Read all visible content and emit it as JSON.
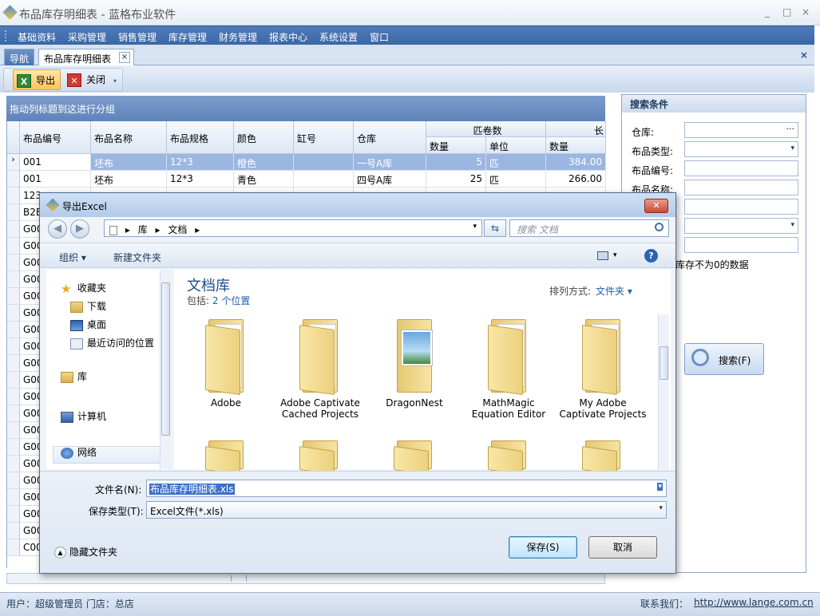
{
  "app": {
    "title": "布品库存明细表 - 蓝格布业软件",
    "window_buttons": [
      "_",
      "□",
      "×"
    ]
  },
  "menu": [
    "基础资料",
    "采购管理",
    "销售管理",
    "库存管理",
    "财务管理",
    "报表中心",
    "系统设置",
    "窗口"
  ],
  "tabs": {
    "nav": "导航",
    "detail": "布品库存明细表",
    "close_glyph": "×",
    "close_all": "×"
  },
  "toolbar": {
    "export": "导出",
    "close": "关闭"
  },
  "grid": {
    "group_hint": "拖动列标题到这进行分组",
    "headers": {
      "code": "布品编号",
      "name": "布品名称",
      "spec": "布品规格",
      "color": "颜色",
      "vat": "缸号",
      "warehouse": "仓库",
      "bolts": "匹卷数",
      "qty": "数量",
      "unit": "单位",
      "long_qty": "数量",
      "long": "长"
    },
    "rows": [
      {
        "marker": "›",
        "code": "001",
        "name": "坯布",
        "spec": "12*3",
        "color": "橙色",
        "vat": "",
        "warehouse": "一号A库",
        "qty": "5",
        "unit": "匹",
        "long_qty": "384.00"
      },
      {
        "marker": "",
        "code": "001",
        "name": "坯布",
        "spec": "12*3",
        "color": "青色",
        "vat": "",
        "warehouse": "四号A库",
        "qty": "25",
        "unit": "匹",
        "long_qty": "266.00"
      },
      {
        "marker": "",
        "code": "123"
      },
      {
        "marker": "",
        "code": "B2B"
      },
      {
        "marker": "",
        "code": "G00"
      },
      {
        "marker": "",
        "code": "G00"
      },
      {
        "marker": "",
        "code": "G00"
      },
      {
        "marker": "",
        "code": "G00"
      },
      {
        "marker": "",
        "code": "G00"
      },
      {
        "marker": "",
        "code": "G00"
      },
      {
        "marker": "",
        "code": "G00"
      },
      {
        "marker": "",
        "code": "G00"
      },
      {
        "marker": "",
        "code": "G00"
      },
      {
        "marker": "",
        "code": "G00"
      },
      {
        "marker": "",
        "code": "G00"
      },
      {
        "marker": "",
        "code": "G00"
      },
      {
        "marker": "",
        "code": "G00"
      },
      {
        "marker": "",
        "code": "G00"
      },
      {
        "marker": "",
        "code": "G00"
      },
      {
        "marker": "",
        "code": "G00"
      },
      {
        "marker": "",
        "code": "G00"
      },
      {
        "marker": "",
        "code": "G00"
      },
      {
        "marker": "",
        "code": "G00"
      },
      {
        "marker": "",
        "code": "C00"
      }
    ]
  },
  "search": {
    "title": "搜索条件",
    "warehouse": "仓库:",
    "warehouse_btn": "···",
    "type": "布品类型:",
    "code": "布品编号:",
    "name": "布品名称:",
    "nonzero": "库存不为0的数据",
    "button": "搜索(F)"
  },
  "status": {
    "user": "用户：超级管理员  门店：总店",
    "contact": "联系我们：",
    "url": "http://www.lange.com.cn"
  },
  "dialog": {
    "title": "导出Excel",
    "close": "✕",
    "nav_back": "◀",
    "nav_fwd": "▶",
    "address": [
      "库",
      "文档"
    ],
    "address_sep": "▸",
    "refresh": "⇆",
    "search_placeholder": "搜索 文档",
    "organize": "组织 ▾",
    "new_folder": "新建文件夹",
    "help": "?",
    "nav_items": {
      "favorites": "收藏夹",
      "downloads": "下载",
      "desktop": "桌面",
      "recent": "最近访问的位置",
      "libraries": "库",
      "computer": "计算机",
      "network": "网络"
    },
    "library_title": "文档库",
    "includes_label": "包括:",
    "includes_link": "2 个位置",
    "sort_label": "排列方式:",
    "sort_value": "文件夹 ▾",
    "folders": [
      "Adobe",
      "Adobe Captivate Cached Projects",
      "DragonNest",
      "MathMagic Equation Editor",
      "My Adobe Captivate Projects"
    ],
    "filename_label": "文件名(N):",
    "filename_value": "布品库存明细表.xls",
    "filetype_label": "保存类型(T):",
    "filetype_value": "Excel文件(*.xls)",
    "save": "保存(S)",
    "cancel": "取消",
    "hide_folders": "隐藏文件夹"
  }
}
